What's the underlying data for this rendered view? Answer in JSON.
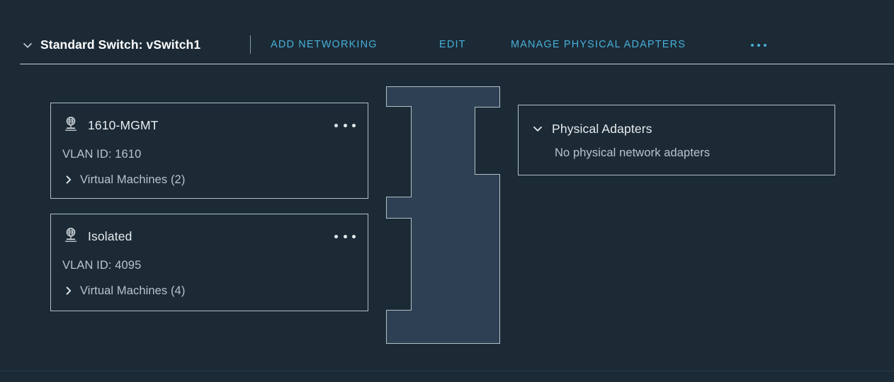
{
  "theme": {
    "background": "#1b2a35",
    "switch_fill": "#2e4154",
    "border": "#b3bfc6",
    "accent_link": "#49afd9",
    "text_primary": "#e6ebee",
    "text_secondary": "#b9c4ca",
    "title": "#ffffff"
  },
  "header": {
    "expand_icon": "chevron-down-icon",
    "title": "Standard Switch: vSwitch1",
    "actions": [
      {
        "label": "ADD NETWORKING"
      },
      {
        "label": "EDIT"
      },
      {
        "label": "MANAGE PHYSICAL ADAPTERS"
      }
    ],
    "overflow_icon": "ellipsis-icon",
    "overflow_label": "..."
  },
  "port_groups": [
    {
      "icon": "port-group-network-icon",
      "name": "1610-MGMT",
      "vlan_label": "VLAN ID: 1610",
      "vms_label": "Virtual Machines (2)",
      "vms_count": 2,
      "vms_expand_icon": "chevron-right-icon",
      "menu_icon": "ellipsis-icon"
    },
    {
      "icon": "port-group-network-icon",
      "name": "Isolated",
      "vlan_label": "VLAN ID: 4095",
      "vms_label": "Virtual Machines (4)",
      "vms_count": 4,
      "vms_expand_icon": "chevron-right-icon",
      "menu_icon": "ellipsis-icon"
    }
  ],
  "switch_graphic": {
    "name": "vswitch-body",
    "port_notches": 3
  },
  "physical_adapters": {
    "expand_icon": "chevron-down-icon",
    "title": "Physical Adapters",
    "empty_message": "No physical network adapters"
  }
}
